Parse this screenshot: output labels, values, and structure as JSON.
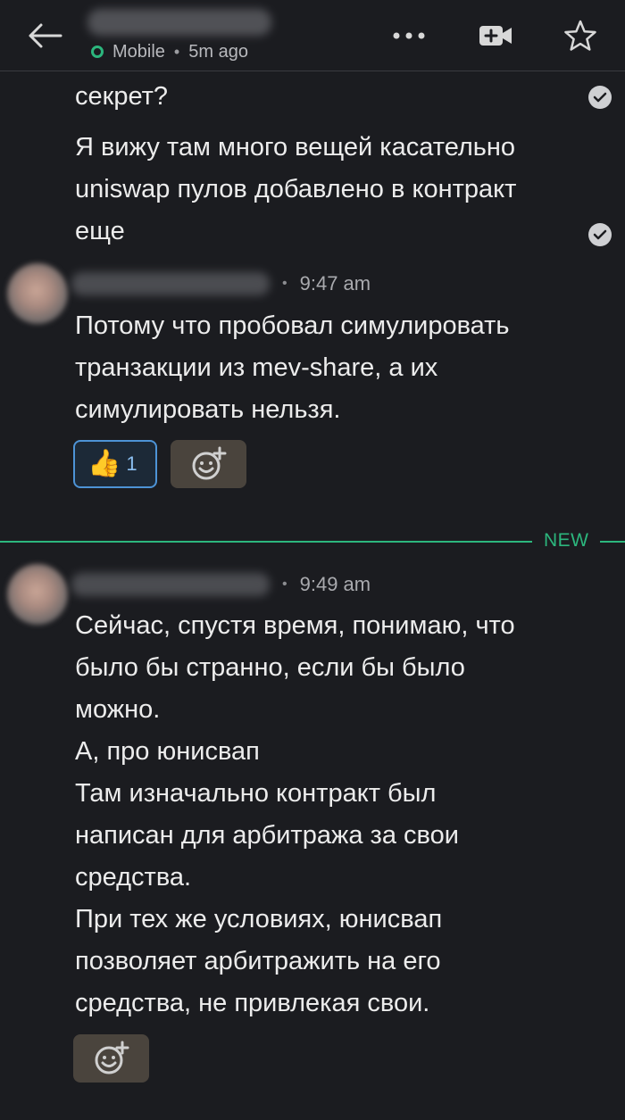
{
  "header": {
    "status": "Mobile",
    "last_active": "5m ago"
  },
  "colors": {
    "background": "#1b1c20",
    "presence": "#2cb67d",
    "new_divider": "#2cb67d",
    "reaction_border": "#4d93d6"
  },
  "messages": {
    "cont_1": "секрет?",
    "cont_2": [
      "Я вижу там много вещей касательно",
      "uniswap пулов добавлено в контракт",
      "еще"
    ],
    "msg_1": {
      "time": "9:47 am",
      "lines": [
        "Потому что пробовал симулировать",
        "транзакции из mev-share, а их",
        "симулировать нельзя."
      ],
      "reaction": {
        "emoji": "👍",
        "count": "1"
      }
    },
    "divider_label": "NEW",
    "msg_2": {
      "time": "9:49 am",
      "lines": [
        "Сейчас, спустя время, понимаю, что",
        "было бы странно, если бы было",
        "можно.",
        "А, про юнисвап",
        "Там изначально контракт был",
        "написан для арбитража за свои",
        "средства.",
        "При тех же условиях, юнисвап",
        "позволяет арбитражить на его",
        "средства, не привлекая свои."
      ]
    }
  },
  "icons": [
    "back-arrow-icon",
    "more-options-icon",
    "video-call-icon",
    "star-icon",
    "read-check-icon",
    "thumbs-up-emoji",
    "add-reaction-icon"
  ]
}
